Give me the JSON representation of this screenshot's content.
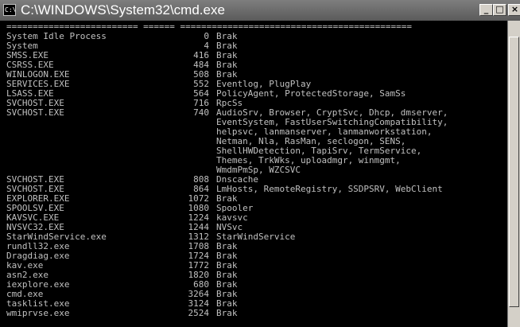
{
  "window": {
    "title": "C:\\WINDOWS\\System32\\cmd.exe",
    "icon_label": "C:\\",
    "buttons": {
      "minimize": "_",
      "maximize": "□",
      "close": "×"
    }
  },
  "console": {
    "separator": "========================= ====== ============================================",
    "rows": [
      {
        "name": "System Idle Process",
        "pid": "0",
        "services": [
          "Brak"
        ]
      },
      {
        "name": "System",
        "pid": "4",
        "services": [
          "Brak"
        ]
      },
      {
        "name": "SMSS.EXE",
        "pid": "416",
        "services": [
          "Brak"
        ]
      },
      {
        "name": "CSRSS.EXE",
        "pid": "484",
        "services": [
          "Brak"
        ]
      },
      {
        "name": "WINLOGON.EXE",
        "pid": "508",
        "services": [
          "Brak"
        ]
      },
      {
        "name": "SERVICES.EXE",
        "pid": "552",
        "services": [
          "Eventlog, PlugPlay"
        ]
      },
      {
        "name": "LSASS.EXE",
        "pid": "564",
        "services": [
          "PolicyAgent, ProtectedStorage, SamSs"
        ]
      },
      {
        "name": "SVCHOST.EXE",
        "pid": "716",
        "services": [
          "RpcSs"
        ]
      },
      {
        "name": "SVCHOST.EXE",
        "pid": "740",
        "services": [
          "AudioSrv, Browser, CryptSvc, Dhcp, dmserver,",
          "EventSystem, FastUserSwitchingCompatibility,",
          "helpsvc, lanmanserver, lanmanworkstation,",
          "Netman, Nla, RasMan, seclogon, SENS,",
          "ShellHWDetection, TapiSrv, TermService,",
          "Themes, TrkWks, uploadmgr, winmgmt,",
          "WmdmPmSp, WZCSVC"
        ]
      },
      {
        "name": "SVCHOST.EXE",
        "pid": "808",
        "services": [
          "Dnscache"
        ]
      },
      {
        "name": "SVCHOST.EXE",
        "pid": "864",
        "services": [
          "LmHosts, RemoteRegistry, SSDPSRV, WebClient"
        ]
      },
      {
        "name": "EXPLORER.EXE",
        "pid": "1072",
        "services": [
          "Brak"
        ]
      },
      {
        "name": "SPOOLSV.EXE",
        "pid": "1080",
        "services": [
          "Spooler"
        ]
      },
      {
        "name": "KAVSVC.EXE",
        "pid": "1224",
        "services": [
          "kavsvc"
        ]
      },
      {
        "name": "NVSVC32.EXE",
        "pid": "1244",
        "services": [
          "NVSvc"
        ]
      },
      {
        "name": "StarWindService.exe",
        "pid": "1312",
        "services": [
          "StarWindService"
        ]
      },
      {
        "name": "rundll32.exe",
        "pid": "1708",
        "services": [
          "Brak"
        ]
      },
      {
        "name": "Dragdiag.exe",
        "pid": "1724",
        "services": [
          "Brak"
        ]
      },
      {
        "name": "kav.exe",
        "pid": "1772",
        "services": [
          "Brak"
        ]
      },
      {
        "name": "asn2.exe",
        "pid": "1820",
        "services": [
          "Brak"
        ]
      },
      {
        "name": "iexplore.exe",
        "pid": "680",
        "services": [
          "Brak"
        ]
      },
      {
        "name": "cmd.exe",
        "pid": "3264",
        "services": [
          "Brak"
        ]
      },
      {
        "name": "tasklist.exe",
        "pid": "3124",
        "services": [
          "Brak"
        ]
      },
      {
        "name": "wmiprvse.exe",
        "pid": "2524",
        "services": [
          "Brak"
        ]
      }
    ]
  }
}
